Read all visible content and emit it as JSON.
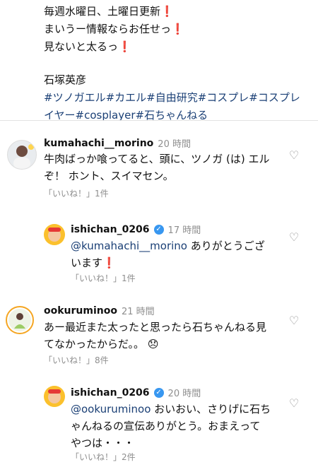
{
  "caption": {
    "lines": [
      "毎週水曜日、土曜日更新",
      "まいうー情報ならお任せっ",
      "見ないと太るっ"
    ],
    "author": "石塚英彦",
    "hashtags": "#ツノガエル#カエル#自由研究#コスプレ#コスプレイヤー#cosplayer#石ちゃんねる"
  },
  "comments": [
    {
      "username": "kumahachi__morino",
      "time": "20 時間",
      "text_line1": "牛肉ばっか喰ってると、頭に、ツノガ (は) エル",
      "text_line2": "ぞ！ ホント、スイマセン。",
      "likes": "「いいね！」1件"
    },
    {
      "username": "ishichan_0206",
      "time": "17 時間",
      "mention": "@kumahachi__morino",
      "text_line1": " ありがとうござ",
      "text_line2": "います",
      "likes": "「いいね！」1件"
    },
    {
      "username": "ookuruminoo",
      "time": "21 時間",
      "text_line1": "あー最近また太ったと思ったら石ちゃんねる見",
      "text_line2": "てなかったからだ。。",
      "emoji": "😞",
      "likes": "「いいね！」8件"
    },
    {
      "username": "ishichan_0206",
      "time": "20 時間",
      "mention": "@ookuruminoo",
      "text_line1": " おいおい、さりげに石ち",
      "text_line2": "ゃんねるの宣伝ありがとう。おまえって",
      "text_line3": "やつは・・・",
      "likes": "「いいね！」2件"
    }
  ],
  "icons": {
    "exclamation": "❗",
    "heart": "♡",
    "verified": "✓"
  }
}
